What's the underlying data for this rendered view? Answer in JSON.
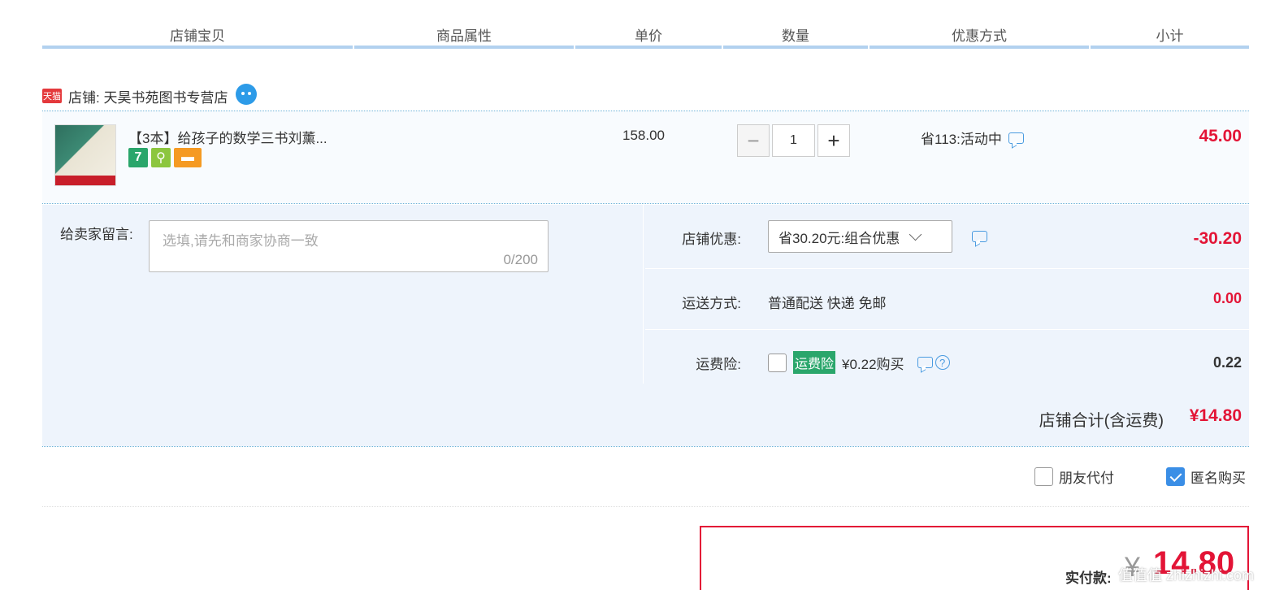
{
  "headers": {
    "shop_item": "店铺宝贝",
    "attributes": "商品属性",
    "unit_price": "单价",
    "quantity": "数量",
    "promotion": "优惠方式",
    "subtotal": "小计"
  },
  "shop": {
    "badge": "天猫",
    "name": "店铺: 天昊书苑图书专营店"
  },
  "item": {
    "title": "【3本】给孩子的数学三书刘薰...",
    "service_icons": [
      "seven-day-return-icon",
      "consumer-protect-icon",
      "credit-card-icon"
    ],
    "unit_price": "158.00",
    "quantity": "1",
    "promotion": "省113:活动中",
    "subtotal": "45.00"
  },
  "message": {
    "label": "给卖家留言:",
    "placeholder": "选填,请先和商家协商一致",
    "counter": "0/200"
  },
  "shop_discount": {
    "label": "店铺优惠:",
    "selected": "省30.20元:组合优惠",
    "amount": "-30.20"
  },
  "shipping": {
    "label": "运送方式:",
    "method": "普通配送 快递 免邮",
    "amount": "0.00"
  },
  "insurance": {
    "label": "运费险:",
    "badge": "运费险",
    "price_text": "¥0.22购买",
    "amount": "0.22"
  },
  "shop_total": {
    "label": "店铺合计(含运费)",
    "value": "¥14.80"
  },
  "extras": {
    "friend_pay": "朋友代付",
    "anonymous": "匿名购买",
    "anonymous_checked": true
  },
  "payment": {
    "label": "实付款:",
    "currency": "¥",
    "value": "14.80"
  },
  "watermark": "值值值 zhizhizhi.com",
  "colors": {
    "price_red": "#e31436",
    "header_line": "#b2d1ef",
    "panel_bg": "#eef4fc"
  }
}
